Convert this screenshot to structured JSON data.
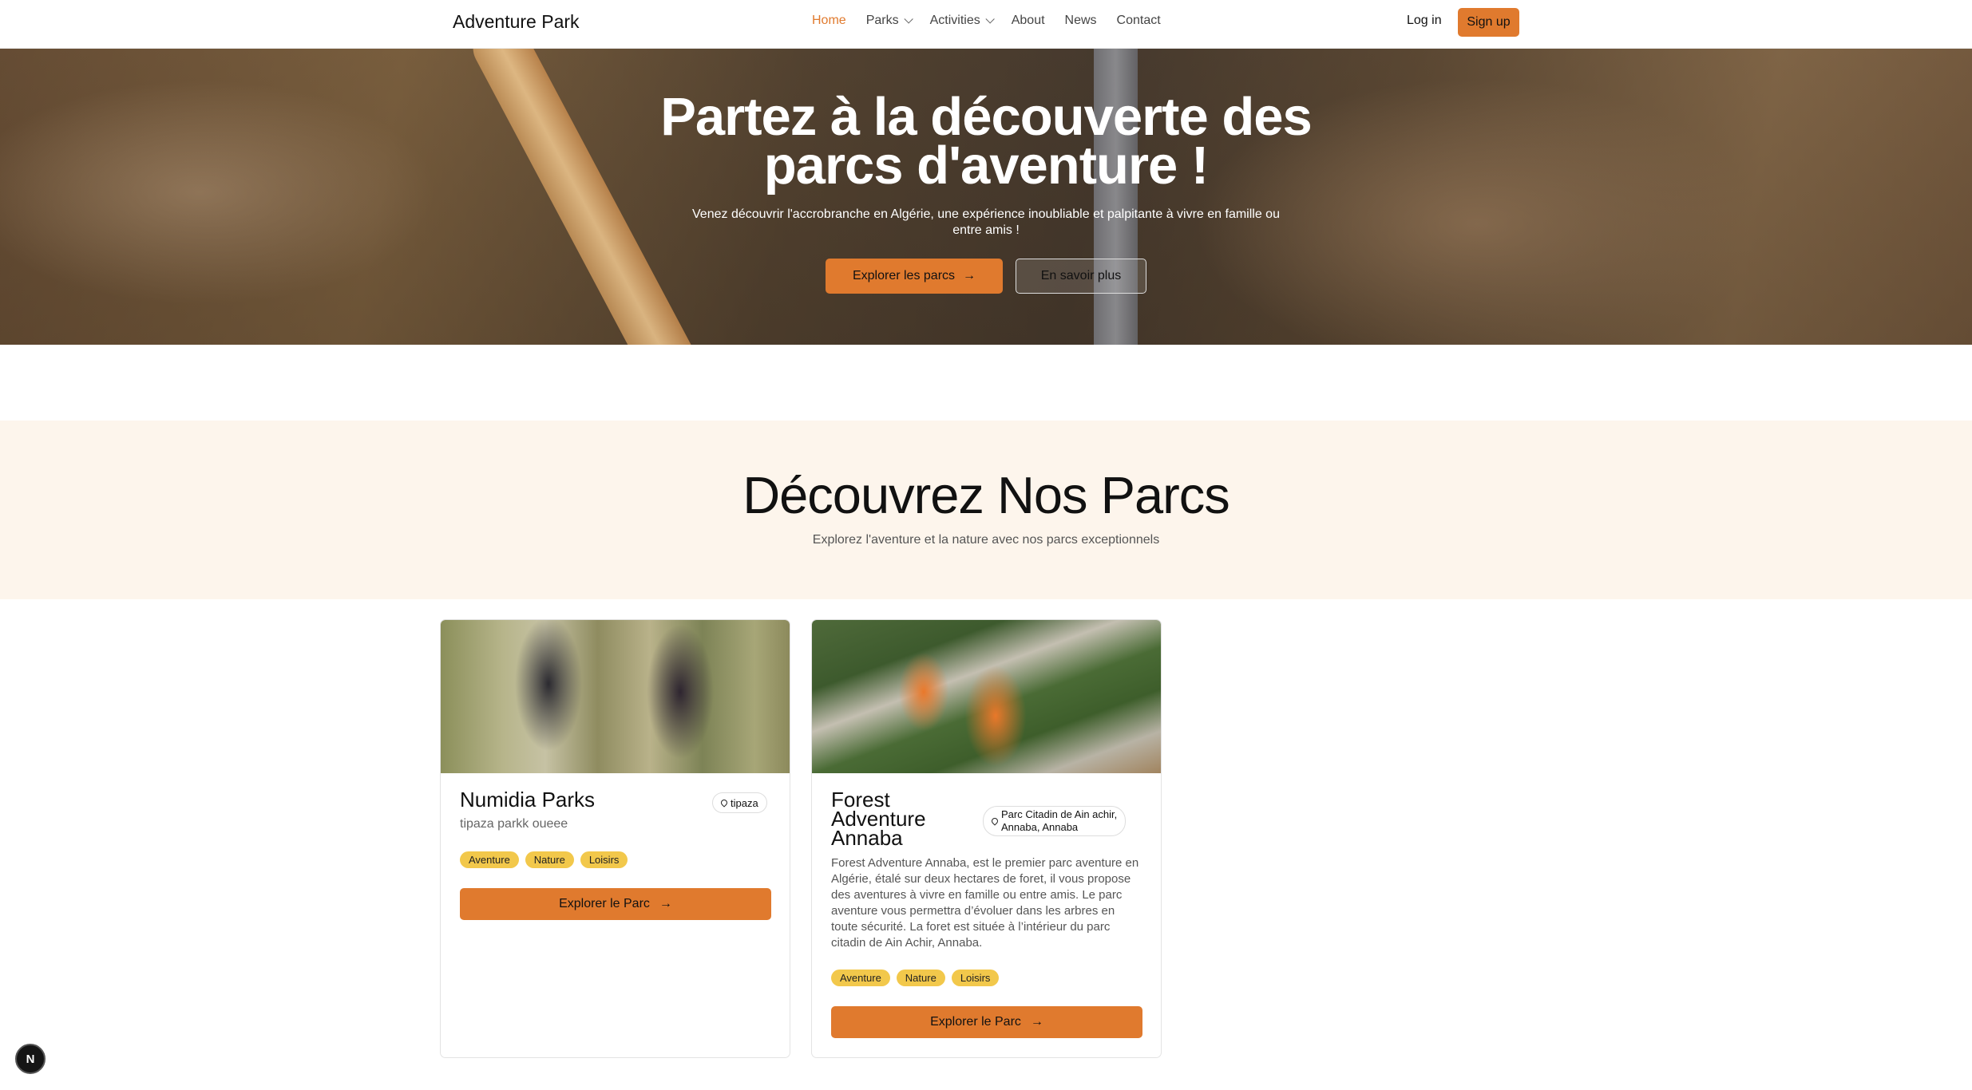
{
  "nav": {
    "brand": "Adventure Park",
    "links": [
      {
        "label": "Home",
        "active": true
      },
      {
        "label": "Parks"
      },
      {
        "label": "Activities"
      },
      {
        "label": "About"
      },
      {
        "label": "News"
      },
      {
        "label": "Contact"
      }
    ],
    "login": "Log in",
    "signup": "Sign up",
    "accent_color": "#e07a2e"
  },
  "hero": {
    "title_line1": "Partez à la découverte des",
    "title_line2": "parcs d'aventure !",
    "subtitle": "Venez découvrir l'accrobranche en Algérie, une expérience inoubliable et palpitante à vivre en famille ou entre amis !",
    "primary_button": "Explorer les parcs",
    "secondary_button": "En savoir plus"
  },
  "section": {
    "title": "Découvrez Nos Parcs",
    "subtitle": "Explorez l'aventure et la nature avec nos parcs exceptionnels"
  },
  "parks": [
    {
      "name": "Numidia Parks",
      "location": "tipaza",
      "description": "tipaza parkk oueee",
      "tags": [
        "Aventure",
        "Nature",
        "Loisirs"
      ],
      "button": "Explorer le Parc"
    },
    {
      "name": "Forest Adventure Annaba",
      "name_line1": "Forest",
      "name_line2": "Adventure",
      "name_line3": "Annaba",
      "location": "Parc Citadin de Ain achir, Annaba, Annaba",
      "location_line1": "Parc Citadin de Ain achir,",
      "location_line2": "Annaba, Annaba",
      "description": "Forest Adventure Annaba, est le premier parc aventure en Algérie, étalé sur deux hectares de foret, il vous propose des aventures à vivre en famille ou entre amis. Le parc aventure vous permettra d’évoluer dans les arbres en toute sécurité. La foret est située à l’intérieur du parc citadin de Ain Achir, Annaba.",
      "tags": [
        "Aventure",
        "Nature",
        "Loisirs"
      ],
      "button": "Explorer le Parc"
    }
  ],
  "badge": "N"
}
